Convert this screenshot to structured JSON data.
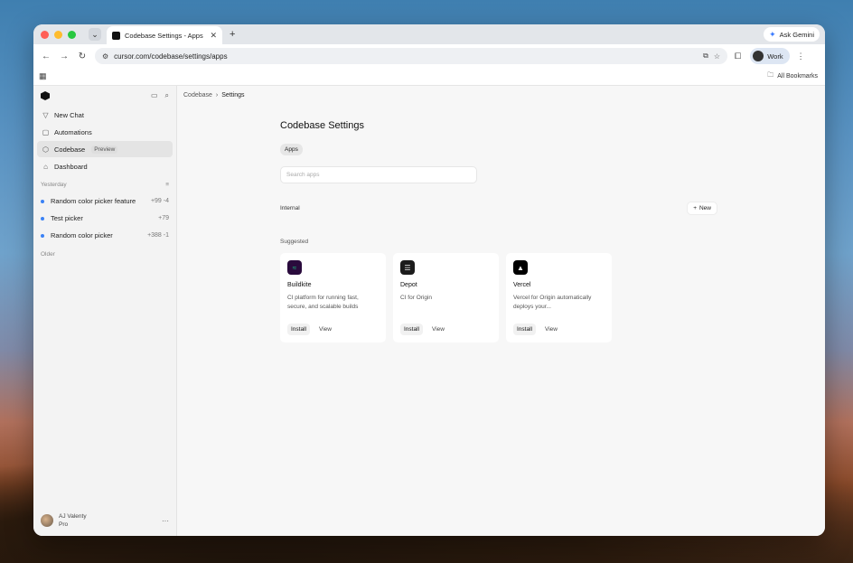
{
  "browser": {
    "tab_title": "Codebase Settings - Apps | C",
    "gemini_label": "Ask Gemini",
    "url": "cursor.com/codebase/settings/apps",
    "profile_label": "Work",
    "all_bookmarks": "All Bookmarks"
  },
  "sidebar": {
    "items": [
      {
        "label": "New Chat",
        "icon": "filter-icon"
      },
      {
        "label": "Automations",
        "icon": "bot-icon"
      },
      {
        "label": "Codebase",
        "icon": "cube-icon",
        "badge": "Preview"
      },
      {
        "label": "Dashboard",
        "icon": "home-icon"
      }
    ],
    "section_yesterday": "Yesterday",
    "history": [
      {
        "name": "Random color picker feature",
        "diff": "+99 -4"
      },
      {
        "name": "Test picker",
        "diff": "+79"
      },
      {
        "name": "Random color picker",
        "diff": "+388 -1"
      }
    ],
    "section_older": "Older",
    "user": {
      "name": "AJ Valenty",
      "plan": "Pro"
    }
  },
  "main": {
    "breadcrumb": [
      "Codebase",
      "Settings"
    ],
    "title": "Codebase Settings",
    "tab_apps": "Apps",
    "search_placeholder": "Search apps",
    "internal_label": "Internal",
    "new_button": "New",
    "suggested_label": "Suggested",
    "cards": [
      {
        "name": "Buildkite",
        "desc": "CI platform for running fast, secure, and scalable builds",
        "install": "Install",
        "view": "View",
        "color": "#14cc80",
        "bg": "#2a0b3d"
      },
      {
        "name": "Depot",
        "desc": "CI for Origin",
        "install": "Install",
        "view": "View",
        "color": "#e9e9e9",
        "bg": "#1c1c1c"
      },
      {
        "name": "Vercel",
        "desc": "Vercel for Origin automatically deploys your...",
        "install": "Install",
        "view": "View",
        "color": "#ffffff",
        "bg": "#000000"
      }
    ]
  }
}
